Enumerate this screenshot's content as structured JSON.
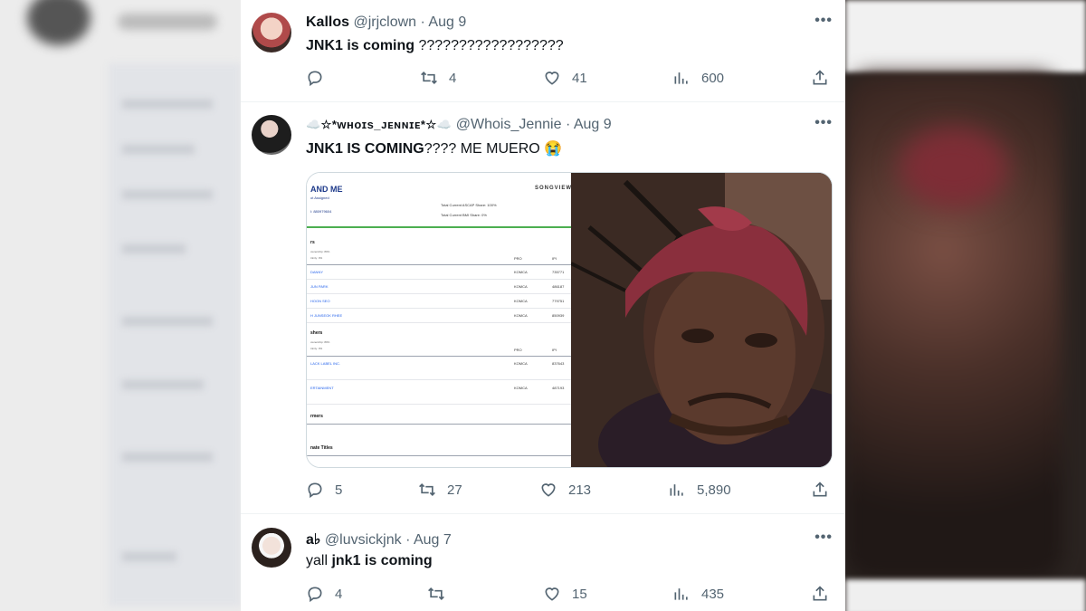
{
  "tweets": [
    {
      "name": "Kallos",
      "handle": "@jrjclown",
      "date": "Aug 9",
      "text_bold": "JNK1 is coming",
      "text_rest": " ??????????????????",
      "stats": {
        "replies": "",
        "retweets": "4",
        "likes": "41",
        "views": "600"
      }
    },
    {
      "name": "☁️☆*ᴡʜᴏɪs_ᴊᴇɴɴɪᴇ*☆☁️",
      "handle": "@Whois_Jennie",
      "date": "Aug 9",
      "text_bold": "JNK1 IS COMING",
      "text_rest": "???? ME MUERO 😭",
      "stats": {
        "replies": "5",
        "retweets": "27",
        "likes": "213",
        "views": "5,890"
      },
      "media_doc": {
        "title": "AND ME",
        "subtitle": "ot Assigned",
        "id_line": "I: 880979604",
        "brand": "SONGVIEW",
        "share1": "Total Current ASCAP Share: 100%",
        "share2": "Total Current BMI Share: 0%",
        "section1": "rs",
        "section1_small1": "ownership: 80%",
        "section1_small2": "trinity: 0%",
        "col_pro": "PRO",
        "col_ipi": "IPI",
        "writers": [
          {
            "name": "DANNY",
            "pro": "KOMCA",
            "ipi": "735771"
          },
          {
            "name": "JUN PARK",
            "pro": "KOMCA",
            "ipi": "486187"
          },
          {
            "name": "HOON SEO",
            "pro": "KOMCA",
            "ipi": "779751"
          },
          {
            "name": "H JUNSEOK RHEE",
            "pro": "KOMCA",
            "ipi": "850939"
          }
        ],
        "section2": "shers",
        "section2_small1": "ownership: 80%",
        "section2_small2": "trinity: 0%",
        "publishers": [
          {
            "name": "LACK LABEL INC.",
            "pro": "KOMCA",
            "ipi": "837643"
          },
          {
            "name": "ERTAINMENT",
            "pro": "KOMCA",
            "ipi": "487193"
          }
        ],
        "section3": "rmers",
        "section4": "nate Titles"
      }
    },
    {
      "name": "a♭",
      "handle": "@luvsickjnk",
      "date": "Aug 7",
      "text_plain": "yall ",
      "text_bold": "jnk1 is coming",
      "stats": {
        "replies": "4",
        "retweets": "",
        "likes": "15",
        "views": "435"
      }
    }
  ],
  "icons": {
    "reply": "reply-icon",
    "retweet": "retweet-icon",
    "like": "like-icon",
    "views": "views-icon",
    "share": "share-icon",
    "more": "more-icon"
  },
  "more_glyph": "•••"
}
